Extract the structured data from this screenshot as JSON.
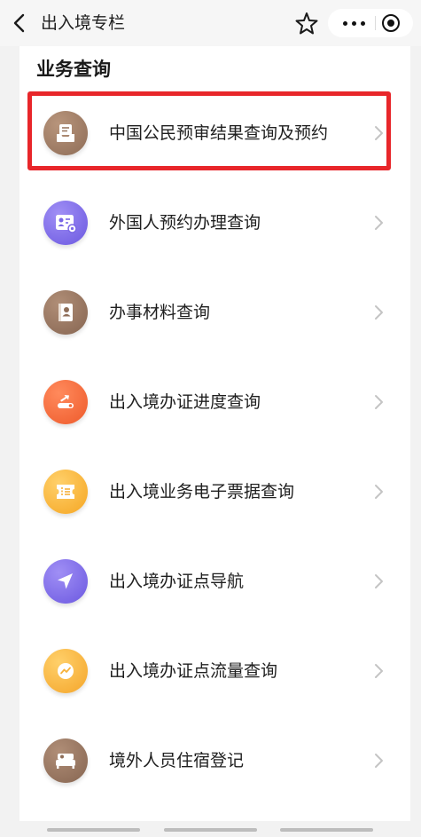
{
  "nav": {
    "title": "出入境专栏"
  },
  "section": {
    "title": "业务查询"
  },
  "items": [
    {
      "label": "中国公民预审结果查询及预约",
      "icon": "document-tray-icon",
      "color": "#9a7a63"
    },
    {
      "label": "外国人预约办理查询",
      "icon": "id-card-icon",
      "color": "#7a67e6"
    },
    {
      "label": "办事材料查询",
      "icon": "profile-book-icon",
      "color": "#8f6e58"
    },
    {
      "label": "出入境办证进度查询",
      "icon": "progress-icon",
      "color": "#f36a3a"
    },
    {
      "label": "出入境业务电子票据查询",
      "icon": "ticket-icon",
      "color": "#f7b13a"
    },
    {
      "label": "出入境办证点导航",
      "icon": "navigation-arrow-icon",
      "color": "#7a67e6"
    },
    {
      "label": "出入境办证点流量查询",
      "icon": "trend-chart-icon",
      "color": "#f6b23c"
    },
    {
      "label": "境外人员住宿登记",
      "icon": "bed-icon",
      "color": "#8f6e58"
    }
  ],
  "colors": {
    "highlight": "#e8262a",
    "background": "#f2f2f2"
  }
}
